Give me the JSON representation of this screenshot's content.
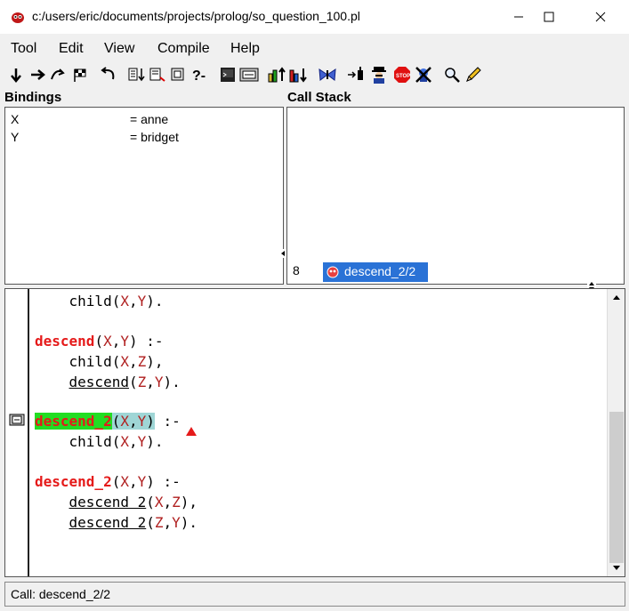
{
  "window": {
    "title": "c:/users/eric/documents/projects/prolog/so_question_100.pl"
  },
  "menu": [
    {
      "label": "Tool",
      "name": "tool"
    },
    {
      "label": "Edit",
      "name": "edit"
    },
    {
      "label": "View",
      "name": "view"
    },
    {
      "label": "Compile",
      "name": "compile"
    },
    {
      "label": "Help",
      "name": "help"
    }
  ],
  "toolbar": {
    "icons": [
      "creep-icon",
      "skip-icon",
      "leap-icon",
      "finish-icon",
      "retry-icon",
      "nodebug-icon",
      "abort-icon",
      "break-icon",
      "query-icon",
      "console-icon",
      "edit-icon",
      "up-icon",
      "down-icon",
      "spy-icon",
      "nospy-icon",
      "debugger-icon",
      "stop-icon",
      "exit-icon",
      "find-icon",
      "pencil-icon"
    ]
  },
  "bindings": {
    "header": "Bindings",
    "rows": [
      {
        "name": "X",
        "value": "= anne"
      },
      {
        "name": "Y",
        "value": "= bridget"
      }
    ]
  },
  "call_stack": {
    "header": "Call Stack",
    "frame_number": "8",
    "frame_label": "descend_2/2"
  },
  "editor": {
    "lines": {
      "l1_pre": "    ",
      "l1_fn": "child",
      "l1_x": "X",
      "l1_y": "Y",
      "l2_fn": "descend",
      "l2_x": "X",
      "l2_y": "Y",
      "l2_tail": " :-",
      "l3_fn": "child",
      "l3_x": "X",
      "l3_y": "Z",
      "l4_fn": "descend",
      "l4_x": "Z",
      "l4_y": "Y",
      "l5_fn": "descend_2",
      "l5_x": "X",
      "l5_y": "Y",
      "l5_tail": " :-",
      "l6_fn": "child",
      "l6_x": "X",
      "l6_y": "Y",
      "l7_fn": "descend_2",
      "l7_x": "X",
      "l7_y": "Y",
      "l7_tail": " :-",
      "l8_fn": "descend 2",
      "l8_x": "X",
      "l8_y": "Z",
      "l9_fn": "descend 2",
      "l9_x": "Z",
      "l9_y": "Y"
    }
  },
  "status": {
    "text": "Call: descend_2/2"
  },
  "colors": {
    "keyword": "#e51a1a",
    "highlight_green": "#22dd22",
    "highlight_teal": "#9fd6d6",
    "selection_blue": "#2a72d6"
  }
}
